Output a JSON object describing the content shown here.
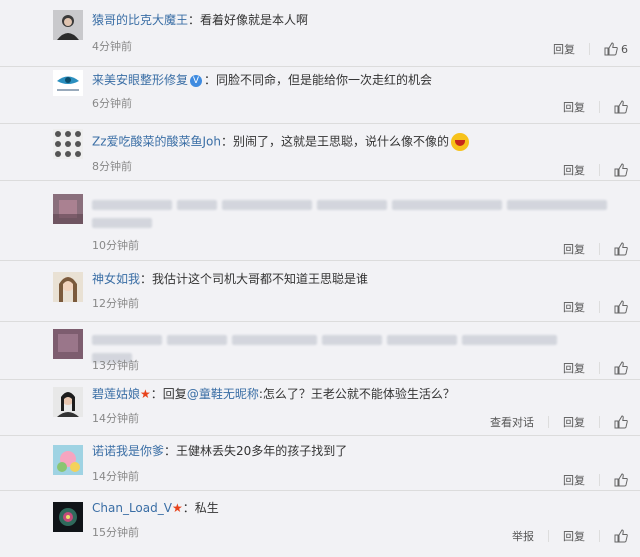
{
  "colors": {
    "username": "#3a6ea5",
    "accent_star": "#e8421b",
    "vip": "#3f8be0"
  },
  "comments": [
    {
      "user": "猿哥的比克大魔王",
      "sep": "：",
      "text": "看着好像就是本人啊",
      "time": "4分钟前",
      "reply": "回复",
      "likes": "6",
      "report": "",
      "view": ""
    },
    {
      "user": "来美安眼整形修复",
      "sep": "：",
      "text": "同脸不同命，但是能给你一次走红的机会",
      "time": "6分钟前",
      "reply": "回复",
      "likes": "",
      "report": "",
      "view": ""
    },
    {
      "user": "Zz爱吃酸菜的酸菜鱼Joh",
      "sep": "：",
      "text": "别闹了，这就是王思聪，说什么像不像的",
      "time": "8分钟前",
      "reply": "回复",
      "likes": "",
      "report": "",
      "view": ""
    },
    {
      "user": "",
      "sep": "",
      "text": "",
      "time": "10分钟前",
      "reply": "回复",
      "likes": "",
      "report": "",
      "view": ""
    },
    {
      "user": "神女如我",
      "sep": "：",
      "text": "我估计这个司机大哥都不知道王思聪是谁",
      "time": "12分钟前",
      "reply": "回复",
      "likes": "",
      "report": "",
      "view": ""
    },
    {
      "user": "",
      "sep": "",
      "text": "",
      "time": "13分钟前",
      "reply": "回复",
      "likes": "",
      "report": "",
      "view": ""
    },
    {
      "user": "碧莲姑娘",
      "sep": "：",
      "text": "怎么了？王老公就不能体验生活么？",
      "reply_prefix": "回复",
      "reply_to": "@童鞋无昵称",
      "time": "14分钟前",
      "reply": "回复",
      "likes": "",
      "report": "",
      "view": "查看对话"
    },
    {
      "user": "诺诺我是你爹",
      "sep": "：",
      "text": "王健林丢失20多年的孩子找到了",
      "time": "14分钟前",
      "reply": "回复",
      "likes": "",
      "report": "",
      "view": ""
    },
    {
      "user": "Chan_Load_V",
      "sep": "：",
      "text": "私生",
      "time": "15分钟前",
      "reply": "回复",
      "likes": "",
      "report": "举报",
      "view": ""
    }
  ]
}
